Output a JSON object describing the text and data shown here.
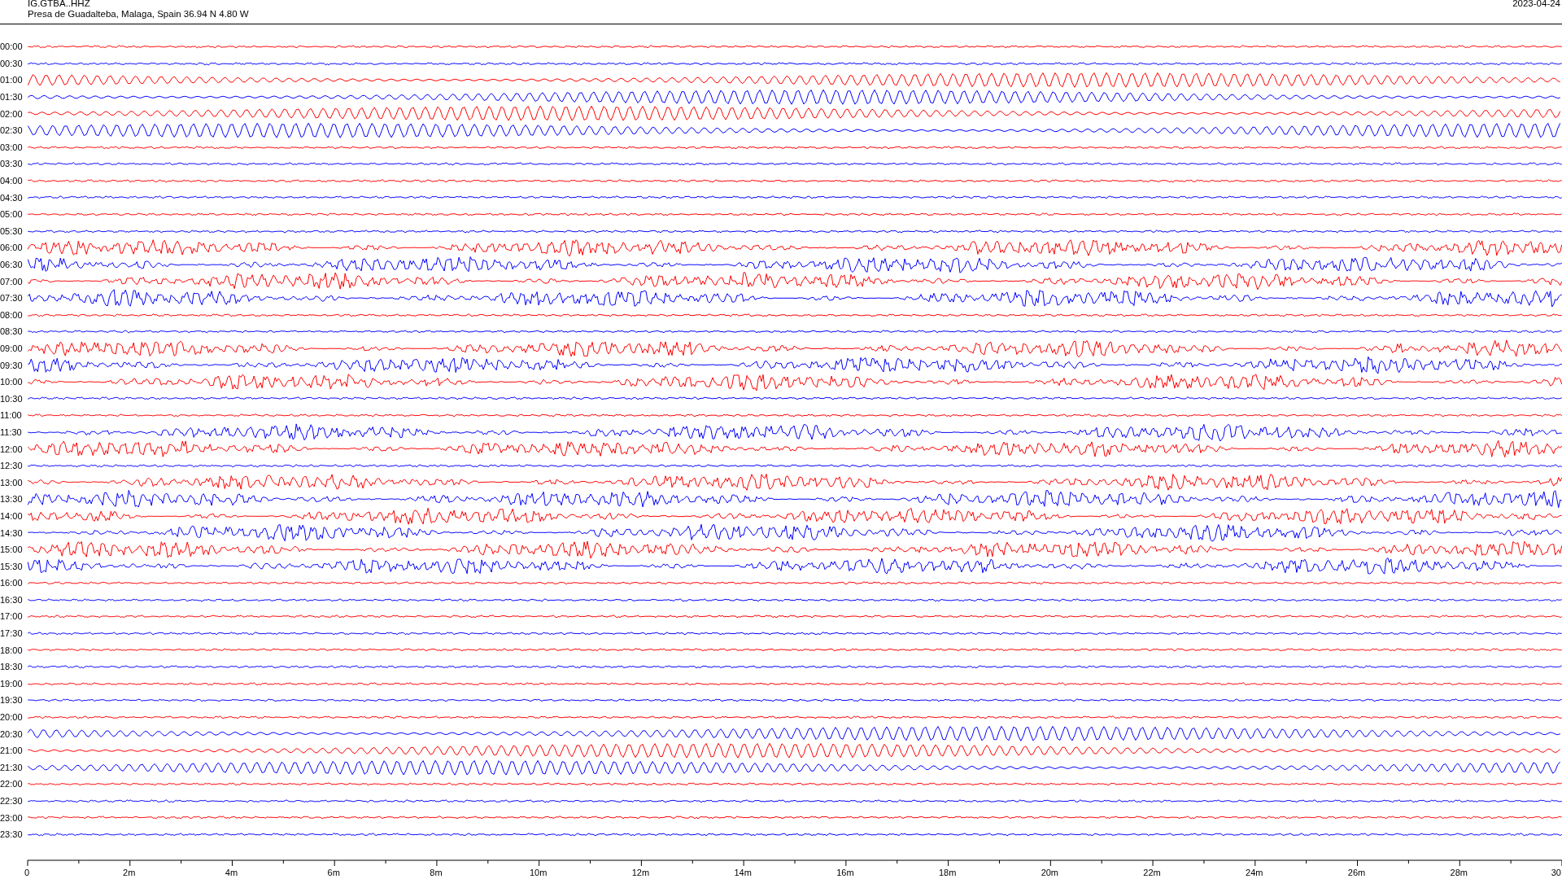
{
  "header": {
    "station": "IG.GTBA..HHZ",
    "location": "Presa de Guadalteba, Malaga, Spain  36.94 N 4.80 W",
    "date": "2023-04-24"
  },
  "traces": [
    {
      "time": "00:00",
      "color": "#ff0000",
      "kind": "quiet"
    },
    {
      "time": "00:30",
      "color": "#0000ff",
      "kind": "quiet"
    },
    {
      "time": "01:00",
      "color": "#ff0000",
      "kind": "wave"
    },
    {
      "time": "01:30",
      "color": "#0000ff",
      "kind": "wave"
    },
    {
      "time": "02:00",
      "color": "#ff0000",
      "kind": "wave"
    },
    {
      "time": "02:30",
      "color": "#0000ff",
      "kind": "wave"
    },
    {
      "time": "03:00",
      "color": "#ff0000",
      "kind": "quiet"
    },
    {
      "time": "03:30",
      "color": "#0000ff",
      "kind": "quiet"
    },
    {
      "time": "04:00",
      "color": "#ff0000",
      "kind": "quiet"
    },
    {
      "time": "04:30",
      "color": "#0000ff",
      "kind": "quiet"
    },
    {
      "time": "05:00",
      "color": "#ff0000",
      "kind": "quiet"
    },
    {
      "time": "05:30",
      "color": "#0000ff",
      "kind": "quiet"
    },
    {
      "time": "06:00",
      "color": "#ff0000",
      "kind": "noisy"
    },
    {
      "time": "06:30",
      "color": "#0000ff",
      "kind": "noisy"
    },
    {
      "time": "07:00",
      "color": "#ff0000",
      "kind": "noisy"
    },
    {
      "time": "07:30",
      "color": "#0000ff",
      "kind": "noisy"
    },
    {
      "time": "08:00",
      "color": "#ff0000",
      "kind": "quiet"
    },
    {
      "time": "08:30",
      "color": "#0000ff",
      "kind": "quiet"
    },
    {
      "time": "09:00",
      "color": "#ff0000",
      "kind": "noisy"
    },
    {
      "time": "09:30",
      "color": "#0000ff",
      "kind": "noisy"
    },
    {
      "time": "10:00",
      "color": "#ff0000",
      "kind": "noisy"
    },
    {
      "time": "10:30",
      "color": "#0000ff",
      "kind": "quiet"
    },
    {
      "time": "11:00",
      "color": "#ff0000",
      "kind": "quiet"
    },
    {
      "time": "11:30",
      "color": "#0000ff",
      "kind": "noisy"
    },
    {
      "time": "12:00",
      "color": "#ff0000",
      "kind": "noisy"
    },
    {
      "time": "12:30",
      "color": "#0000ff",
      "kind": "quiet"
    },
    {
      "time": "13:00",
      "color": "#ff0000",
      "kind": "noisy"
    },
    {
      "time": "13:30",
      "color": "#0000ff",
      "kind": "noisy"
    },
    {
      "time": "14:00",
      "color": "#ff0000",
      "kind": "noisy"
    },
    {
      "time": "14:30",
      "color": "#0000ff",
      "kind": "noisy"
    },
    {
      "time": "15:00",
      "color": "#ff0000",
      "kind": "noisy"
    },
    {
      "time": "15:30",
      "color": "#0000ff",
      "kind": "noisy"
    },
    {
      "time": "16:00",
      "color": "#ff0000",
      "kind": "quiet"
    },
    {
      "time": "16:30",
      "color": "#0000ff",
      "kind": "quiet"
    },
    {
      "time": "17:00",
      "color": "#ff0000",
      "kind": "quiet"
    },
    {
      "time": "17:30",
      "color": "#0000ff",
      "kind": "quiet"
    },
    {
      "time": "18:00",
      "color": "#ff0000",
      "kind": "quiet"
    },
    {
      "time": "18:30",
      "color": "#0000ff",
      "kind": "quiet"
    },
    {
      "time": "19:00",
      "color": "#ff0000",
      "kind": "quiet"
    },
    {
      "time": "19:30",
      "color": "#0000ff",
      "kind": "quiet"
    },
    {
      "time": "20:00",
      "color": "#ff0000",
      "kind": "quiet"
    },
    {
      "time": "20:30",
      "color": "#0000ff",
      "kind": "wave"
    },
    {
      "time": "21:00",
      "color": "#ff0000",
      "kind": "wave"
    },
    {
      "time": "21:30",
      "color": "#0000ff",
      "kind": "wave"
    },
    {
      "time": "22:00",
      "color": "#ff0000",
      "kind": "quiet"
    },
    {
      "time": "22:30",
      "color": "#0000ff",
      "kind": "quiet"
    },
    {
      "time": "23:00",
      "color": "#ff0000",
      "kind": "quiet"
    },
    {
      "time": "23:30",
      "color": "#0000ff",
      "kind": "quiet"
    }
  ],
  "x_axis": {
    "labels": [
      "0",
      "2m",
      "4m",
      "6m",
      "8m",
      "10m",
      "12m",
      "14m",
      "16m",
      "18m",
      "20m",
      "22m",
      "24m",
      "26m",
      "28m",
      "30"
    ]
  }
}
